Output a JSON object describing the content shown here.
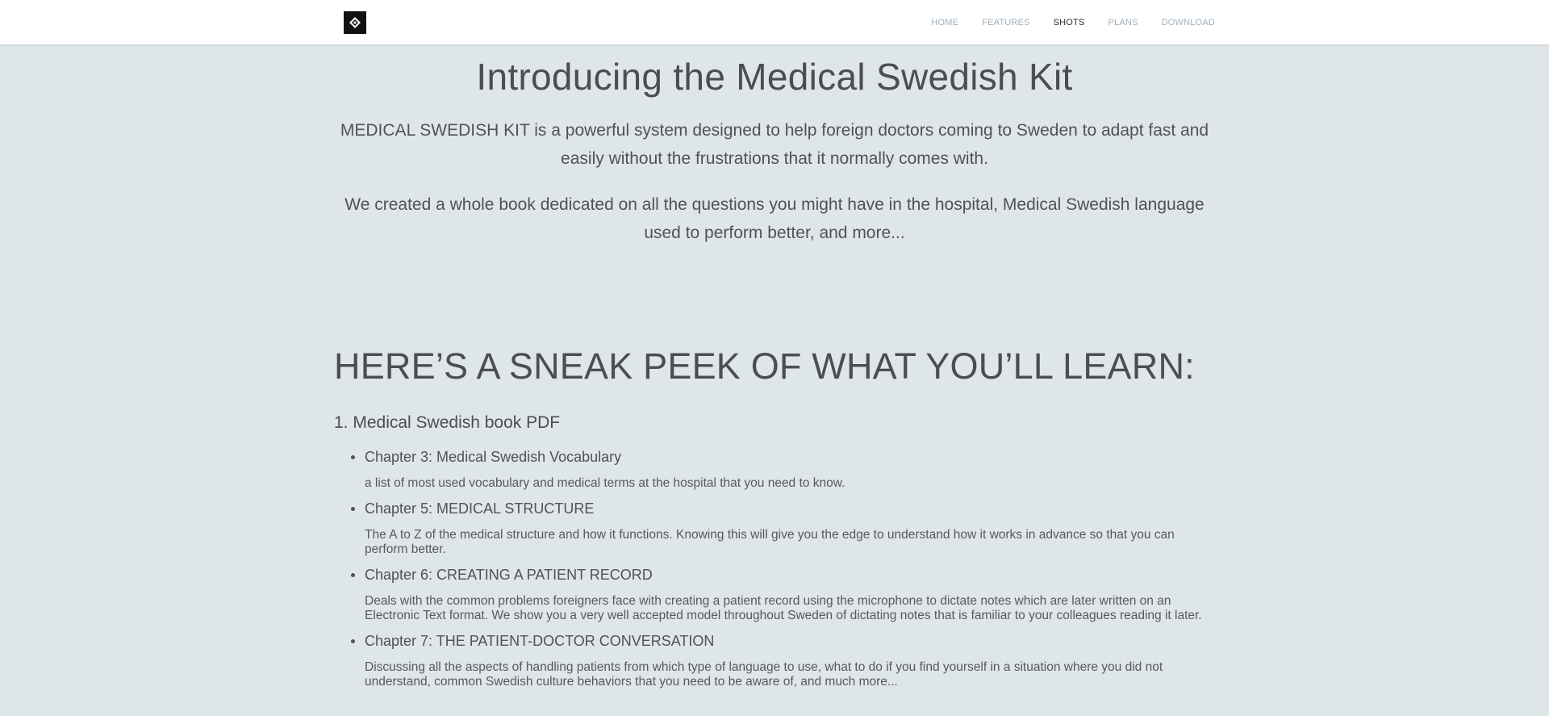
{
  "nav": {
    "logo_icon": "diamond-logo-icon",
    "items": [
      {
        "label": "HOME",
        "active": false
      },
      {
        "label": "FEATURES",
        "active": false
      },
      {
        "label": "SHOTS",
        "active": true
      },
      {
        "label": "PLANS",
        "active": false
      },
      {
        "label": "DOWNLOAD",
        "active": false
      }
    ]
  },
  "hero": {
    "title": "Introducing the Medical Swedish Kit",
    "paragraph1": "MEDICAL SWEDISH KIT is a powerful system designed to help foreign doctors coming to Sweden to adapt fast and easily without the frustrations that it normally comes with.",
    "paragraph2": "We created a whole book dedicated on all the questions you might have in the hospital, Medical Swedish language used to perform better, and more..."
  },
  "learn": {
    "heading": "HERE’S A SNEAK PEEK OF WHAT YOU’LL LEARN:",
    "book_title": "1. Medical Swedish book PDF",
    "chapters": [
      {
        "name": "Chapter 3: Medical Swedish Vocabulary",
        "desc": "a list of most used vocabulary and medical terms at the hospital that you need to know."
      },
      {
        "name": "Chapter 5: MEDICAL STRUCTURE",
        "desc": "The A to Z of the medical structure and how it functions. Knowing this will give you the edge to understand how it works in advance so that you can perform better."
      },
      {
        "name": "Chapter 6: CREATING A PATIENT RECORD",
        "desc": "Deals with the common problems foreigners face with creating a patient record using the microphone to dictate notes which are later written on an Electronic Text format. We show you a very well accepted model throughout Sweden of dictating notes that is familiar to your colleagues reading it later."
      },
      {
        "name": "Chapter 7: THE PATIENT-DOCTOR CONVERSATION",
        "desc": "Discussing all the aspects of handling patients from which type of language to use, what to do if you find yourself in a situation where you did not understand, common Swedish culture behaviors that you need to be aware of, and much more..."
      }
    ]
  },
  "colors": {
    "page_background": "#dfe6ea",
    "navbar_background": "#ffffff",
    "nav_link": "#9fb0bb",
    "nav_link_active": "#2b2e31",
    "text": "#4b4e51"
  }
}
